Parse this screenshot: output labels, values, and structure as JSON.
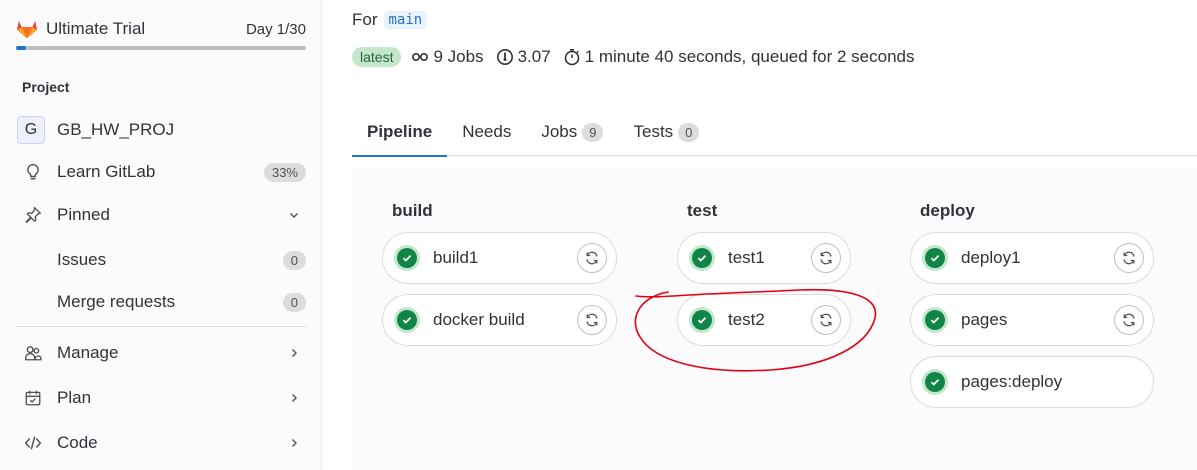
{
  "sidebar": {
    "trial": {
      "name": "Ultimate Trial",
      "day": "Day 1/30",
      "progress": 0.033
    },
    "section_title": "Project",
    "project": {
      "avatar_letter": "G",
      "name": "GB_HW_PROJ"
    },
    "learn": {
      "label": "Learn GitLab",
      "badge": "33%"
    },
    "pinned": {
      "label": "Pinned"
    },
    "pinned_items": [
      {
        "label": "Issues",
        "count": "0"
      },
      {
        "label": "Merge requests",
        "count": "0"
      }
    ],
    "groups": [
      {
        "label": "Manage",
        "icon": "users-icon"
      },
      {
        "label": "Plan",
        "icon": "calendar-icon"
      },
      {
        "label": "Code",
        "icon": "code-icon"
      }
    ]
  },
  "header": {
    "for_label": "For",
    "ref": "main",
    "latest_badge": "latest",
    "jobs": "9 Jobs",
    "score": "3.07",
    "duration": "1 minute 40 seconds, queued for 2 seconds"
  },
  "tabs": [
    {
      "label": "Pipeline",
      "count": null,
      "active": true
    },
    {
      "label": "Needs",
      "count": null,
      "active": false
    },
    {
      "label": "Jobs",
      "count": "9",
      "active": false
    },
    {
      "label": "Tests",
      "count": "0",
      "active": false
    }
  ],
  "stages": [
    {
      "name": "build",
      "jobs": [
        {
          "name": "build1",
          "status": "passed",
          "retry": true
        },
        {
          "name": "docker build",
          "status": "passed",
          "retry": true
        }
      ]
    },
    {
      "name": "test",
      "jobs": [
        {
          "name": "test1",
          "status": "passed",
          "retry": true
        },
        {
          "name": "test2",
          "status": "passed",
          "retry": true
        }
      ]
    },
    {
      "name": "deploy",
      "jobs": [
        {
          "name": "deploy1",
          "status": "passed",
          "retry": true
        },
        {
          "name": "pages",
          "status": "passed",
          "retry": true
        },
        {
          "name": "pages:deploy",
          "status": "passed",
          "retry": false
        }
      ]
    }
  ],
  "colors": {
    "accent": "#1f75cb",
    "success": "#108548",
    "annotation": "#e3000f"
  }
}
